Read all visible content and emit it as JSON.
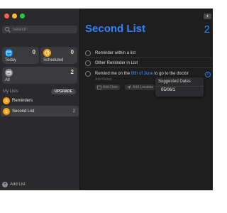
{
  "sidebar": {
    "search_placeholder": "Search",
    "smart_lists": [
      {
        "label": "Today",
        "count": "0",
        "color": "#0a84ff"
      },
      {
        "label": "Scheduled",
        "count": "0",
        "color": "#ff9f0a"
      },
      {
        "label": "All",
        "count": "2",
        "color": "#8e8e93"
      }
    ],
    "my_lists_label": "My Lists",
    "upgrade_label": "UPGRADE",
    "lists": [
      {
        "name": "Reminders",
        "count": "",
        "color": "#ff9f0a"
      },
      {
        "name": "Second List",
        "count": "2",
        "color": "#ff9f0a"
      }
    ],
    "add_list_label": "Add List"
  },
  "main": {
    "add_button_label": "+",
    "title": "Second List",
    "count": "2",
    "reminders": [
      {
        "text": "Reminder within a list"
      },
      {
        "text": "Other Reminder in List"
      }
    ],
    "editing": {
      "prefix": "Remind me on the ",
      "highlight": "fifth of June",
      "suffix": " to go to the doctor",
      "notes_placeholder": "Add Notes",
      "add_date_label": "Add Date",
      "add_location_label": "Add Location"
    },
    "suggestions": {
      "title": "Suggested Dates",
      "items": [
        "05/06/1"
      ]
    }
  },
  "colors": {
    "accent": "#2f84ff",
    "sidebar_bg": "#2a2a2c",
    "main_bg": "#1e1e1e",
    "traffic_close": "#ff5f57",
    "traffic_min": "#febc2e",
    "traffic_max": "#28c840"
  }
}
